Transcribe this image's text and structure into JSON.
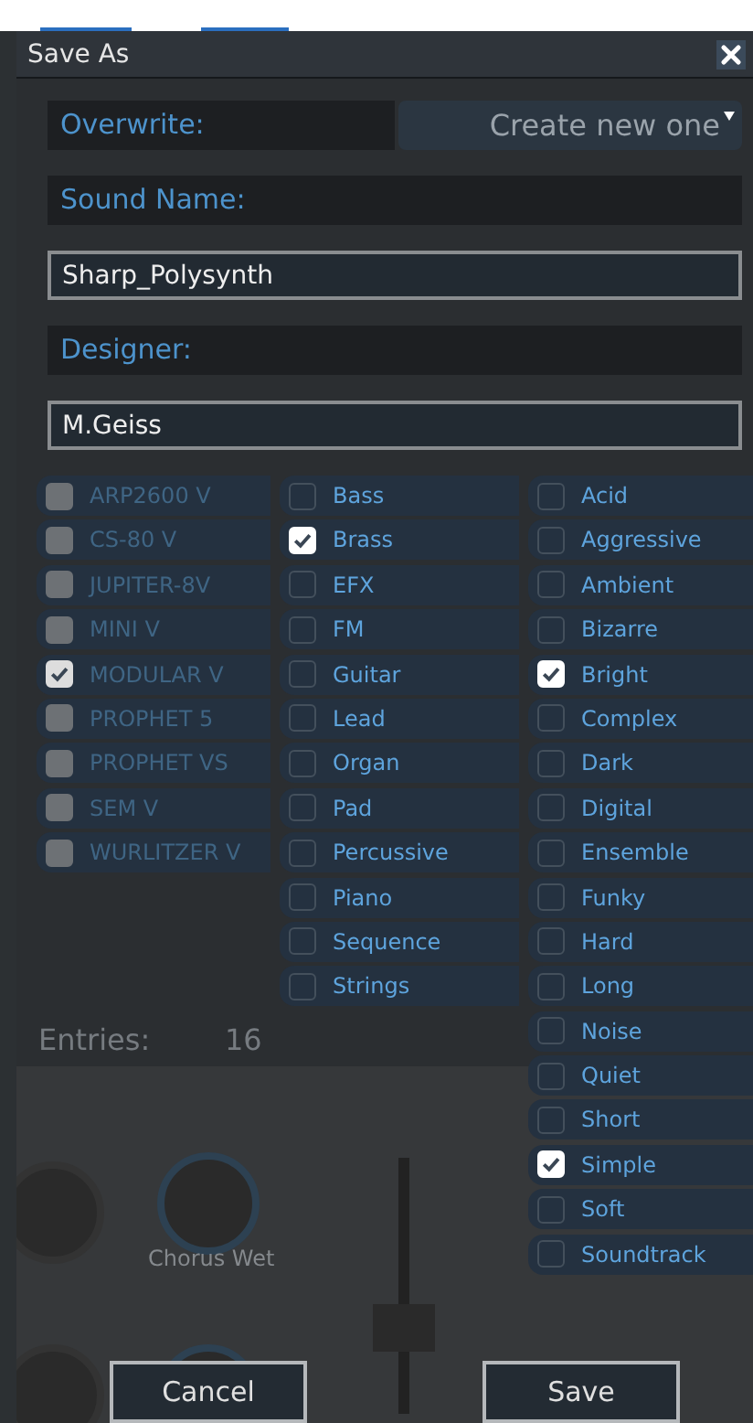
{
  "dialog": {
    "title": "Save As"
  },
  "overwrite": {
    "label": "Overwrite:",
    "value": "Create new one"
  },
  "sound_name": {
    "label": "Sound Name:",
    "value": "Sharp_Polysynth"
  },
  "designer": {
    "label": "Designer:",
    "value": "M.Geiss"
  },
  "instruments": [
    {
      "label": "ARP2600 V",
      "checked": false,
      "disabled": true
    },
    {
      "label": "CS-80 V",
      "checked": false,
      "disabled": true
    },
    {
      "label": "JUPITER-8V",
      "checked": false,
      "disabled": true
    },
    {
      "label": "MINI V",
      "checked": false,
      "disabled": true
    },
    {
      "label": "MODULAR V",
      "checked": true,
      "disabled": true
    },
    {
      "label": "PROPHET 5",
      "checked": false,
      "disabled": true
    },
    {
      "label": "PROPHET VS",
      "checked": false,
      "disabled": true
    },
    {
      "label": "SEM V",
      "checked": false,
      "disabled": true
    },
    {
      "label": "WURLITZER V",
      "checked": false,
      "disabled": true
    }
  ],
  "types": [
    {
      "label": "Bass",
      "checked": false
    },
    {
      "label": "Brass",
      "checked": true
    },
    {
      "label": "EFX",
      "checked": false
    },
    {
      "label": "FM",
      "checked": false
    },
    {
      "label": "Guitar",
      "checked": false
    },
    {
      "label": "Lead",
      "checked": false
    },
    {
      "label": "Organ",
      "checked": false
    },
    {
      "label": "Pad",
      "checked": false
    },
    {
      "label": "Percussive",
      "checked": false
    },
    {
      "label": "Piano",
      "checked": false
    },
    {
      "label": "Sequence",
      "checked": false
    },
    {
      "label": "Strings",
      "checked": false
    }
  ],
  "characteristics": [
    {
      "label": "Acid",
      "checked": false
    },
    {
      "label": "Aggressive",
      "checked": false
    },
    {
      "label": "Ambient",
      "checked": false
    },
    {
      "label": "Bizarre",
      "checked": false
    },
    {
      "label": "Bright",
      "checked": true
    },
    {
      "label": "Complex",
      "checked": false
    },
    {
      "label": "Dark",
      "checked": false
    },
    {
      "label": "Digital",
      "checked": false
    },
    {
      "label": "Ensemble",
      "checked": false
    },
    {
      "label": "Funky",
      "checked": false
    },
    {
      "label": "Hard",
      "checked": false
    },
    {
      "label": "Long",
      "checked": false
    },
    {
      "label": "Noise",
      "checked": false
    },
    {
      "label": "Quiet",
      "checked": false
    },
    {
      "label": "Short",
      "checked": false
    },
    {
      "label": "Simple",
      "checked": true
    },
    {
      "label": "Soft",
      "checked": false
    },
    {
      "label": "Soundtrack",
      "checked": false
    }
  ],
  "background": {
    "entries_label": "Entries:",
    "entries_count": "16",
    "knob_label": "Chorus Wet"
  },
  "buttons": [
    {
      "label": "Cancel"
    },
    {
      "label": "Save"
    }
  ]
}
